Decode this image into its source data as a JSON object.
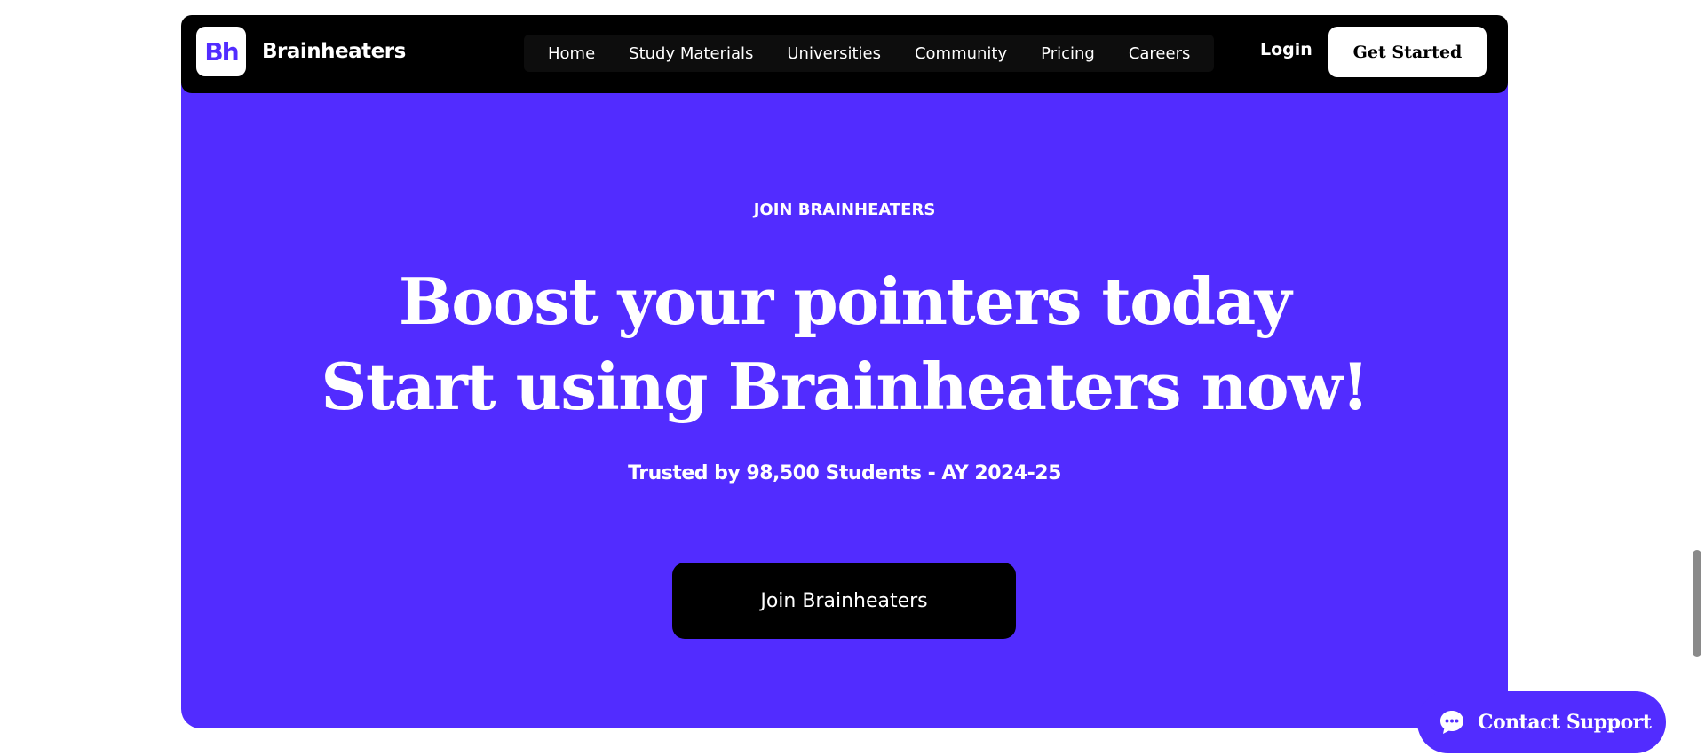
{
  "navbar": {
    "logo_text": "Bh",
    "brand_name": "Brainheaters",
    "links": [
      "Home",
      "Study Materials",
      "Universities",
      "Community",
      "Pricing",
      "Careers"
    ],
    "login_label": "Login",
    "get_started_label": "Get Started"
  },
  "hero": {
    "eyebrow": "JOIN BRAINHEATERS",
    "headline_line1": "Boost your pointers today",
    "headline_line2": "Start using Brainheaters now!",
    "trusted_text": "Trusted by 98,500 Students - AY 2024-25",
    "cta_label": "Join Brainheaters"
  },
  "support": {
    "label": "Contact Support",
    "icon": "chat-bubble-icon"
  },
  "colors": {
    "brand_purple": "#522cff",
    "navbar_bg": "#000000",
    "page_bg": "#ffffff"
  }
}
